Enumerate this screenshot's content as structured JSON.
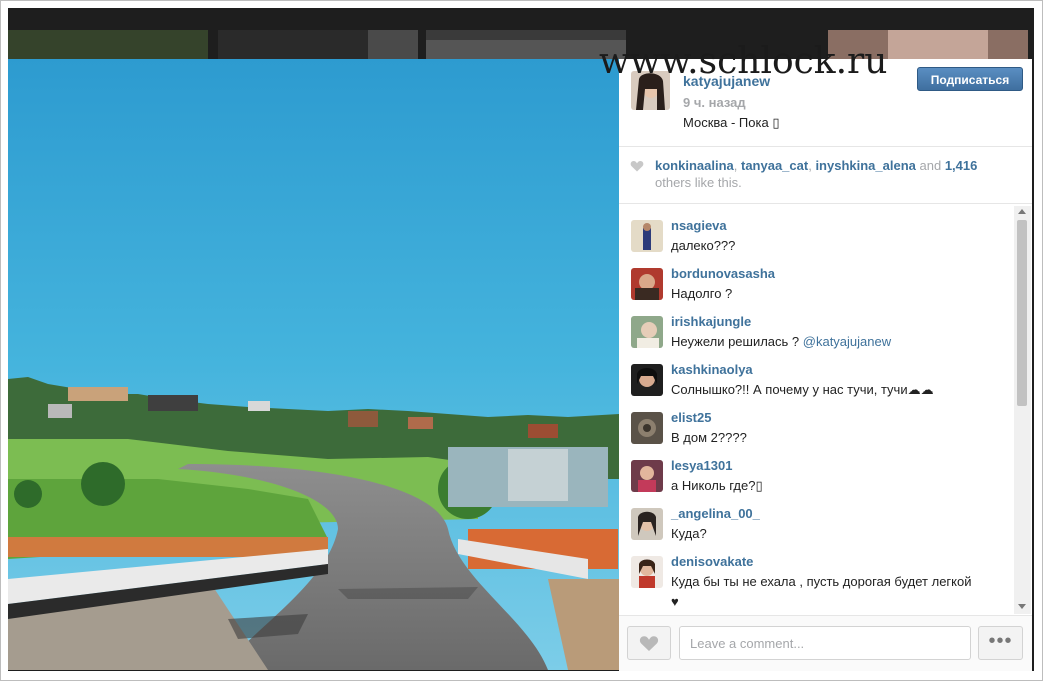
{
  "watermark": "www.schlock.ru",
  "post": {
    "username": "katyajujanew",
    "time_ago": "9 ч. назад",
    "caption": "Москва - Пока ▯",
    "follow_label": "Подписаться"
  },
  "likes": {
    "users": [
      "konkinaalina",
      "tanyaa_cat",
      "inyshkina_alena"
    ],
    "sep1": ", ",
    "sep2": ", ",
    "and_text": " and ",
    "count": "1,416",
    "suffix": " others like this."
  },
  "comments": [
    {
      "user": "nsagieva",
      "text": "далеко???"
    },
    {
      "user": "bordunovasasha",
      "text": "Надолго ?"
    },
    {
      "user": "irishkajungle",
      "text": "Неужели решилась ? ",
      "mention": "@katyajujanew"
    },
    {
      "user": "kashkinaolya",
      "text": "Солнышко?!! А почему у нас тучи, тучи☁☁"
    },
    {
      "user": "elist25",
      "text": "В дом 2????"
    },
    {
      "user": "lesya1301",
      "text": "а Николь где?▯"
    },
    {
      "user": "_angelina_00_",
      "text": "Куда?"
    },
    {
      "user": "denisovakate",
      "text": "Куда бы ты не ехала , пусть дорогая будет легкой",
      "text2": "♥"
    }
  ],
  "footer": {
    "comment_placeholder": "Leave a comment...",
    "more_label": "•••"
  },
  "icons": {
    "heart": "heart-icon",
    "more": "more-options-icon"
  },
  "colors": {
    "link": "#3f729b",
    "muted": "#a5a7aa",
    "follow_button": "#4a7fb3"
  }
}
